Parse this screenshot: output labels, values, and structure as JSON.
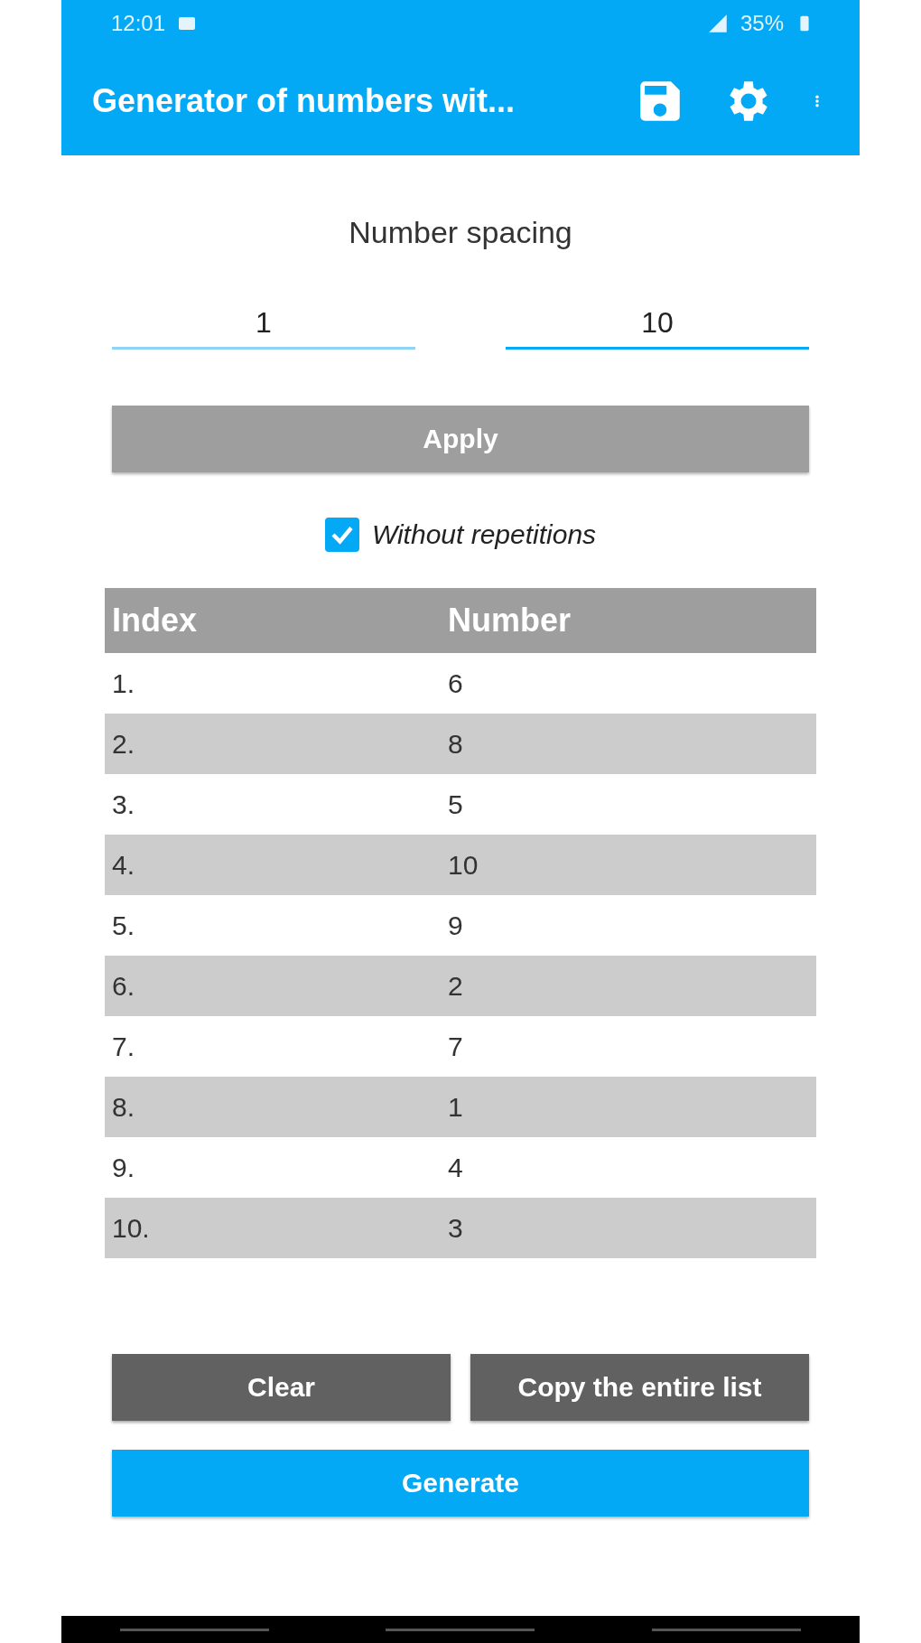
{
  "status_bar": {
    "time": "12:01",
    "battery": "35%"
  },
  "app_bar": {
    "title": "Generator of numbers wit..."
  },
  "heading": "Number spacing",
  "range": {
    "from": "1",
    "to": "10"
  },
  "apply_button": "Apply",
  "without_repetitions": {
    "label": "Without repetitions",
    "checked": true
  },
  "table": {
    "columns": [
      "Index",
      "Number"
    ],
    "rows": [
      {
        "index": "1.",
        "number": "6"
      },
      {
        "index": "2.",
        "number": "8"
      },
      {
        "index": "3.",
        "number": "5"
      },
      {
        "index": "4.",
        "number": "10"
      },
      {
        "index": "5.",
        "number": "9"
      },
      {
        "index": "6.",
        "number": "2"
      },
      {
        "index": "7.",
        "number": "7"
      },
      {
        "index": "8.",
        "number": "1"
      },
      {
        "index": "9.",
        "number": "4"
      },
      {
        "index": "10.",
        "number": "3"
      }
    ]
  },
  "buttons": [
    "Clear",
    "Copy the entire list"
  ],
  "generate_button": "Generate"
}
